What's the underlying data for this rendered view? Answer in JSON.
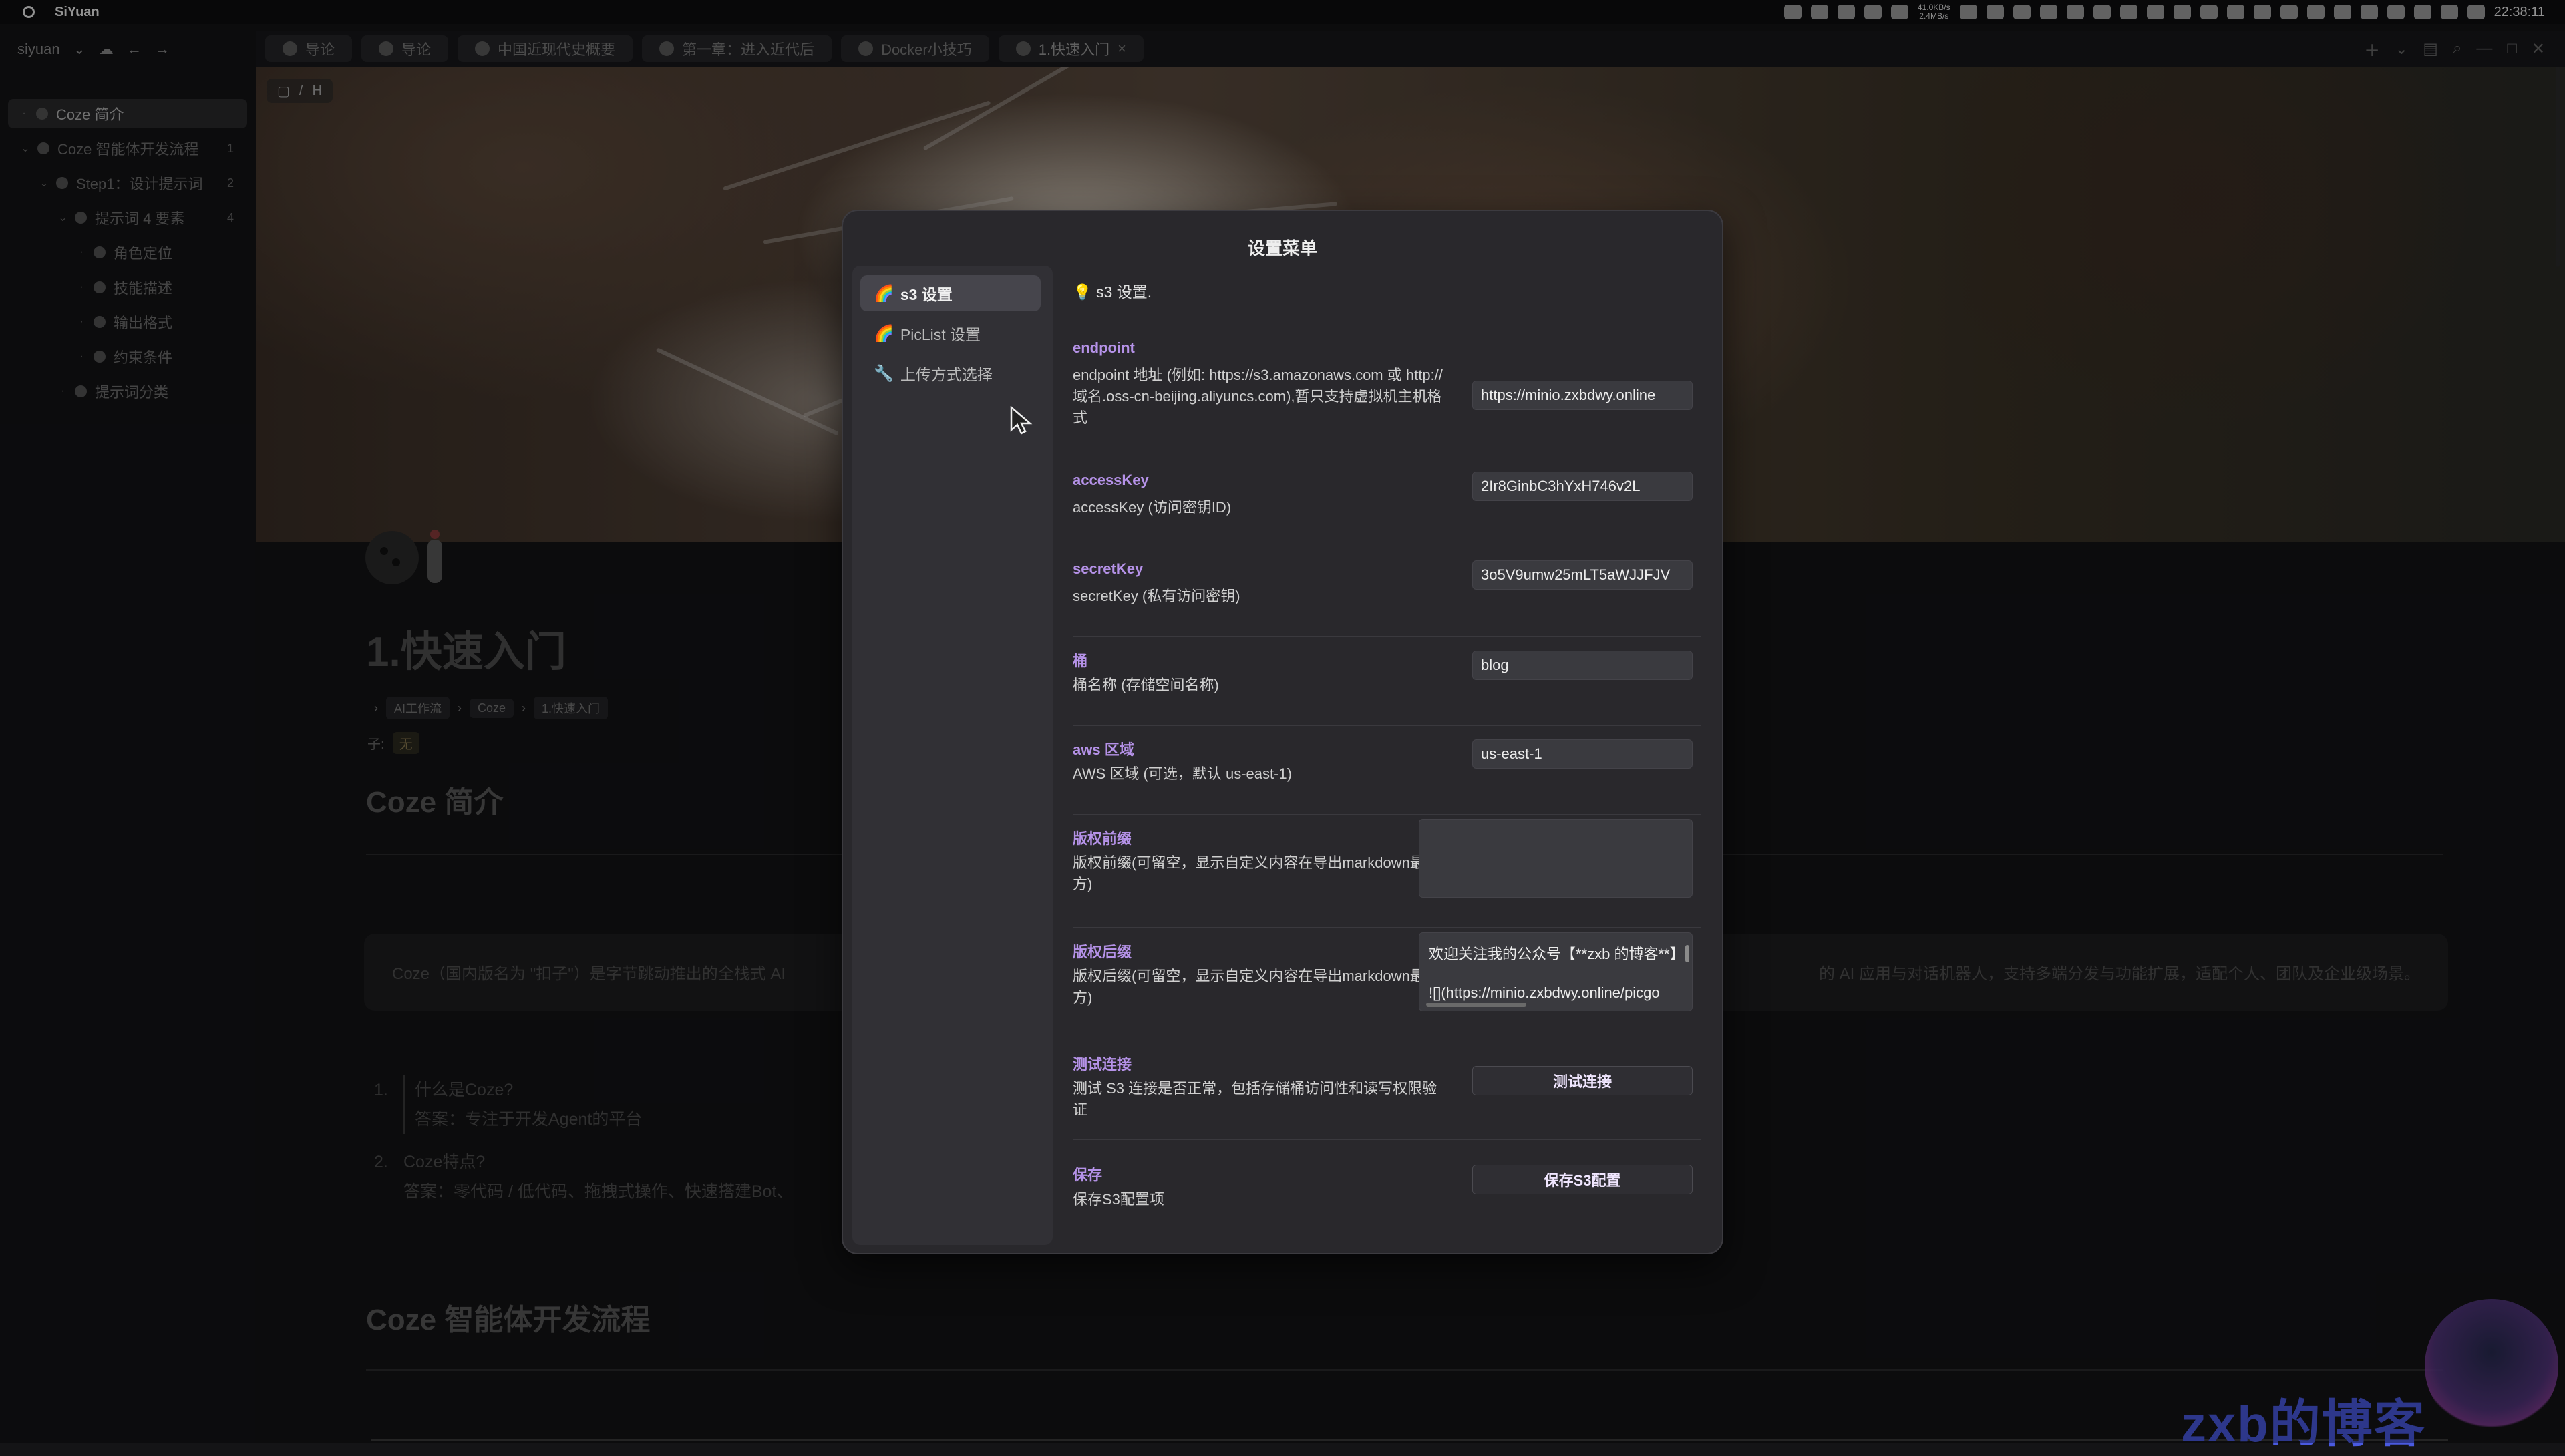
{
  "app": {
    "name": "SiYuan"
  },
  "tray": {
    "net_up": "41.0KB/s",
    "net_down": "2.4MB/s",
    "clock": "22:38:11"
  },
  "workspace": {
    "name": "siyuan"
  },
  "tabs": [
    {
      "label": "导论"
    },
    {
      "label": "导论"
    },
    {
      "label": "中国近现代史概要"
    },
    {
      "label": "第一章：进入近代后"
    },
    {
      "label": "Docker小技巧"
    },
    {
      "label": "1.快速入门"
    }
  ],
  "sidebar": {
    "items": [
      {
        "label": "Coze 简介",
        "count": ""
      },
      {
        "label": "Coze 智能体开发流程",
        "count": "1"
      },
      {
        "label": "Step1：设计提示词",
        "count": "2"
      },
      {
        "label": "提示词 4 要素",
        "count": "4"
      },
      {
        "label": "角色定位",
        "count": ""
      },
      {
        "label": "技能描述",
        "count": ""
      },
      {
        "label": "输出格式",
        "count": ""
      },
      {
        "label": "约束条件",
        "count": ""
      },
      {
        "label": "提示词分类",
        "count": ""
      }
    ]
  },
  "doc": {
    "title": "1.快速入门",
    "breadcrumb": [
      "AI工作流",
      "Coze",
      "1.快速入门"
    ],
    "sub_label": "子:",
    "sub_value": "无",
    "h2_intro": "Coze 简介",
    "quote_left": "Coze（国内版名为 \"扣子\"）是字节跳动推出的全栈式 AI",
    "quote_right": "的 AI 应用与对话机器人，支持多端分发与功能扩展，适配个人、团队及企业级场景。",
    "list": [
      {
        "num": "1.",
        "q": "什么是Coze?",
        "a": "答案：专注于开发Agent的平台"
      },
      {
        "num": "2.",
        "q": "Coze特点?",
        "a": "答案：零代码 / 低代码、拖拽式操作、快速搭建Bot、"
      }
    ],
    "h2_flow": "Coze 智能体开发流程"
  },
  "watermark": "zxb的博客",
  "modal": {
    "title": "设置菜单",
    "nav": [
      {
        "icon": "🌈",
        "label": "s3 设置"
      },
      {
        "icon": "🌈",
        "label": "PicList 设置"
      },
      {
        "icon": "🔧",
        "label": "上传方式选择"
      }
    ],
    "intro": "💡 s3 设置.",
    "fields": {
      "endpoint": {
        "label": "endpoint",
        "desc": "endpoint 地址 (例如: https://s3.amazonaws.com 或 http://域名.oss-cn-beijing.aliyuncs.com),暂只支持虚拟机主机格式",
        "value": "https://minio.zxbdwy.online"
      },
      "accessKey": {
        "label": "accessKey",
        "desc": "accessKey (访问密钥ID)",
        "value": "2Ir8GinbC3hYxH746v2L"
      },
      "secretKey": {
        "label": "secretKey",
        "desc": "secretKey (私有访问密钥)",
        "value": "3o5V9umw25mLT5aWJJFJV"
      },
      "bucket": {
        "label": "桶",
        "desc": "桶名称 (存储空间名称)",
        "value": "blog"
      },
      "region": {
        "label": "aws 区域",
        "desc": "AWS 区域 (可选，默认 us-east-1)",
        "value": "us-east-1"
      },
      "prefix": {
        "label": "版权前缀",
        "desc": "版权前缀(可留空，显示自定义内容在导出markdown最上方)",
        "value": ""
      },
      "suffix": {
        "label": "版权后缀",
        "desc": "版权后缀(可留空，显示自定义内容在导出markdown最下方)",
        "line1": "欢迎关注我的公众号【**zxb 的博客**】",
        "line2": "![](https://minio.zxbdwy.online/picgo"
      },
      "test": {
        "label": "测试连接",
        "desc": "测试 S3 连接是否正常，包括存储桶访问性和读写权限验证",
        "button": "测试连接"
      },
      "save": {
        "label": "保存",
        "desc": "保存S3配置项",
        "button": "保存S3配置"
      }
    }
  }
}
